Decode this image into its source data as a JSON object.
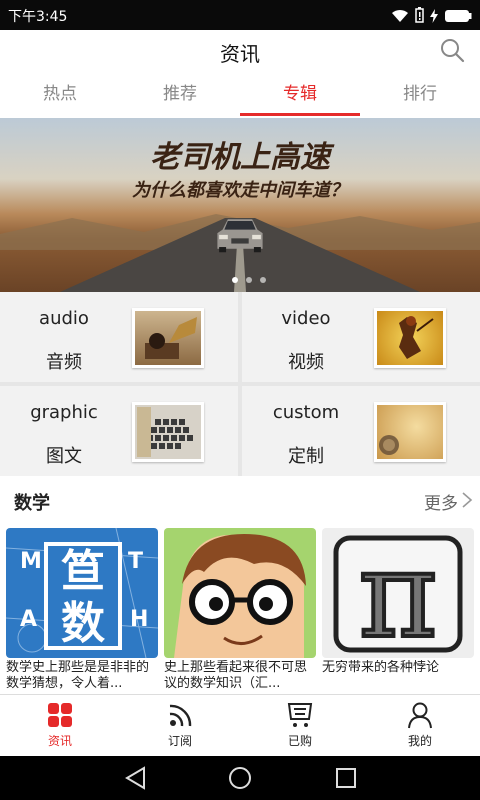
{
  "status_bar": {
    "time": "下午3:45",
    "icons": [
      "wifi-icon",
      "battery-alert-icon",
      "charging-icon",
      "battery-icon"
    ]
  },
  "header": {
    "title": "资讯",
    "search_icon": "search-icon"
  },
  "tabs": [
    {
      "label": "热点",
      "active": false
    },
    {
      "label": "推荐",
      "active": false
    },
    {
      "label": "专辑",
      "active": true
    },
    {
      "label": "排行",
      "active": false
    }
  ],
  "banner": {
    "title": "老司机上高速",
    "subtitle": "为什么都喜欢走中间车道？",
    "page_count": 3,
    "current_page": 1
  },
  "categories": [
    {
      "en": "audio",
      "zh": "音频"
    },
    {
      "en": "video",
      "zh": "视频"
    },
    {
      "en": "graphic",
      "zh": "图文"
    },
    {
      "en": "custom",
      "zh": "定制"
    }
  ],
  "section": {
    "title": "数学",
    "more": "更多"
  },
  "cards": [
    {
      "text": "数学史上那些是是非非的数学猜想，令人着..."
    },
    {
      "text": "史上那些看起来很不可思议的数学知识（汇..."
    },
    {
      "text": "无穷带来的各种悖论"
    }
  ],
  "card1_tile": {
    "line1": "笪",
    "line2": "数",
    "letters": [
      "M",
      "A",
      "T",
      "H"
    ]
  },
  "card3_tile": {
    "symbol": "π"
  },
  "bottom_nav": [
    {
      "label": "资讯",
      "active": true,
      "icon": "grid-icon"
    },
    {
      "label": "订阅",
      "active": false,
      "icon": "rss-icon"
    },
    {
      "label": "已购",
      "active": false,
      "icon": "cart-icon"
    },
    {
      "label": "我的",
      "active": false,
      "icon": "person-icon"
    }
  ],
  "colors": {
    "accent": "#e52a2a",
    "tab_inactive": "#888888",
    "status_bar": "#0a0a0a"
  }
}
